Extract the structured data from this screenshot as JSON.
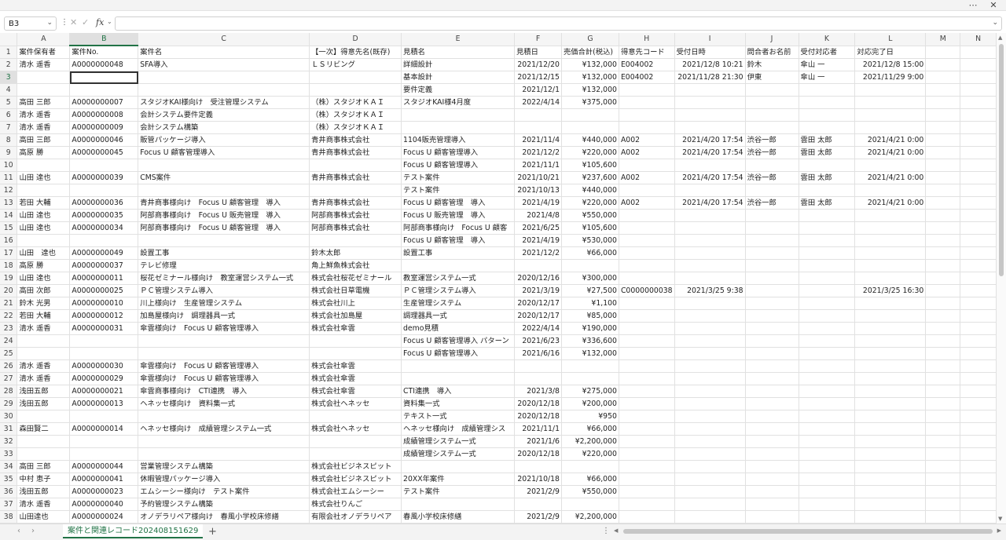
{
  "window": {
    "menu_icon": "more-horizontal-icon",
    "close_icon": "close-icon"
  },
  "formula_bar": {
    "name_box": "B3",
    "formula": ""
  },
  "columns": [
    "A",
    "B",
    "C",
    "D",
    "E",
    "F",
    "G",
    "H",
    "I",
    "J",
    "K",
    "L",
    "M",
    "N"
  ],
  "selected": {
    "row": 3,
    "col": "B"
  },
  "rows": [
    [
      "案件保有者",
      "案件No.",
      "案件名",
      "【一次】得意先名(既存)",
      "見積名",
      "見積日",
      "売価合計(税込)",
      "得意先コード",
      "受付日時",
      "問合者お名前",
      "受付対応者",
      "対応完了日",
      "",
      ""
    ],
    [
      "清水 遥香",
      "A0000000048",
      "SFA導入",
      "ＬＳリビング",
      "詳細設計",
      "2021/12/20",
      "¥132,000",
      "E004002",
      "2021/12/8 10:21",
      "鈴木",
      "傘山 一",
      "2021/12/8 15:00",
      "",
      ""
    ],
    [
      "",
      "",
      "",
      "",
      "基本設計",
      "2021/12/15",
      "¥132,000",
      "E004002",
      "2021/11/28 21:30",
      "伊東",
      "傘山 一",
      "2021/11/29 9:00",
      "",
      ""
    ],
    [
      "",
      "",
      "",
      "",
      "要件定義",
      "2021/12/1",
      "¥132,000",
      "",
      "",
      "",
      "",
      "",
      "",
      ""
    ],
    [
      "高田 三郎",
      "A0000000007",
      "スタジオKAI様向け　受注管理システム",
      "（株）スタジオＫＡＩ",
      "スタジオKAI様4月度",
      "2022/4/14",
      "¥375,000",
      "",
      "",
      "",
      "",
      "",
      "",
      ""
    ],
    [
      "清水 遥香",
      "A0000000008",
      "会計システム要件定義",
      "（株）スタジオＫＡＩ",
      "",
      "",
      "",
      "",
      "",
      "",
      "",
      "",
      "",
      ""
    ],
    [
      "清水 遥香",
      "A0000000009",
      "会計システム構築",
      "（株）スタジオＫＡＩ",
      "",
      "",
      "",
      "",
      "",
      "",
      "",
      "",
      "",
      ""
    ],
    [
      "高田 三郎",
      "A0000000046",
      "販管パッケージ導入",
      "青井商事株式会社",
      "1104販売管理導入",
      "2021/11/4",
      "¥440,000",
      "A002",
      "2021/4/20 17:54",
      "渋谷一郎",
      "雲田 太郎",
      "2021/4/21 0:00",
      "",
      ""
    ],
    [
      "高原 勝",
      "A0000000045",
      "Focus U 顧客管理導入",
      "青井商事株式会社",
      "Focus U 顧客管理導入",
      "2021/12/2",
      "¥220,000",
      "A002",
      "2021/4/20 17:54",
      "渋谷一郎",
      "雲田 太郎",
      "2021/4/21 0:00",
      "",
      ""
    ],
    [
      "",
      "",
      "",
      "",
      "Focus U 顧客管理導入",
      "2021/11/1",
      "¥105,600",
      "",
      "",
      "",
      "",
      "",
      "",
      ""
    ],
    [
      "山田 達也",
      "A0000000039",
      "CMS案件",
      "青井商事株式会社",
      "テスト案件",
      "2021/10/21",
      "¥237,600",
      "A002",
      "2021/4/20 17:54",
      "渋谷一郎",
      "雲田 太郎",
      "2021/4/21 0:00",
      "",
      ""
    ],
    [
      "",
      "",
      "",
      "",
      "テスト案件",
      "2021/10/13",
      "¥440,000",
      "",
      "",
      "",
      "",
      "",
      "",
      ""
    ],
    [
      "若田 大輔",
      "A0000000036",
      "青井商事様向け　Focus U 顧客管理　導入",
      "青井商事株式会社",
      "Focus U 顧客管理　導入",
      "2021/4/19",
      "¥220,000",
      "A002",
      "2021/4/20 17:54",
      "渋谷一郎",
      "雲田 太郎",
      "2021/4/21 0:00",
      "",
      ""
    ],
    [
      "山田 達也",
      "A0000000035",
      "阿部商事様向け　Focus U 販売管理　導入",
      "阿部商事株式会社",
      "Focus U 販売管理　導入",
      "2021/4/8",
      "¥550,000",
      "",
      "",
      "",
      "",
      "",
      "",
      ""
    ],
    [
      "山田 達也",
      "A0000000034",
      "阿部商事様向け　Focus U 顧客管理　導入",
      "阿部商事株式会社",
      "阿部商事様向け　Focus U 顧客",
      "2021/6/25",
      "¥105,600",
      "",
      "",
      "",
      "",
      "",
      "",
      ""
    ],
    [
      "",
      "",
      "",
      "",
      "Focus U 顧客管理　導入",
      "2021/4/19",
      "¥530,000",
      "",
      "",
      "",
      "",
      "",
      "",
      ""
    ],
    [
      "山田　達也",
      "A0000000049",
      "設置工事",
      "鈴木太郎",
      "設置工事",
      "2021/12/2",
      "¥66,000",
      "",
      "",
      "",
      "",
      "",
      "",
      ""
    ],
    [
      "高原 勝",
      "A0000000037",
      "テレビ修理",
      "角上鮮魚株式会社",
      "",
      "",
      "",
      "",
      "",
      "",
      "",
      "",
      "",
      ""
    ],
    [
      "山田 達也",
      "A0000000011",
      "桜花ゼミナール様向け　教室運営システム一式",
      "株式会社桜花ゼミナール",
      "教室運営システム一式",
      "2020/12/16",
      "¥300,000",
      "",
      "",
      "",
      "",
      "",
      "",
      ""
    ],
    [
      "高田 次郎",
      "A0000000025",
      "ＰＣ管理システム導入",
      "株式会社日草電機",
      "ＰＣ管理システム導入",
      "2021/3/19",
      "¥27,500",
      "C0000000038",
      "2021/3/25 9:38",
      "",
      "",
      "2021/3/25 16:30",
      "",
      ""
    ],
    [
      "鈴木 光男",
      "A0000000010",
      "川上様向け　生産管理システム",
      "株式会社川上",
      "生産管理システム",
      "2020/12/17",
      "¥1,100",
      "",
      "",
      "",
      "",
      "",
      "",
      ""
    ],
    [
      "若田 大輔",
      "A0000000012",
      "加島屋様向け　調理器具一式",
      "株式会社加島屋",
      "調理器具一式",
      "2020/12/17",
      "¥85,000",
      "",
      "",
      "",
      "",
      "",
      "",
      ""
    ],
    [
      "清水 遥香",
      "A0000000031",
      "傘雲様向け　Focus U 顧客管理導入",
      "株式会社傘雲",
      "demo見積",
      "2022/4/14",
      "¥190,000",
      "",
      "",
      "",
      "",
      "",
      "",
      ""
    ],
    [
      "",
      "",
      "",
      "",
      "Focus U 顧客管理導入 パターン",
      "2021/6/23",
      "¥336,600",
      "",
      "",
      "",
      "",
      "",
      "",
      ""
    ],
    [
      "",
      "",
      "",
      "",
      "Focus U 顧客管理導入",
      "2021/6/16",
      "¥132,000",
      "",
      "",
      "",
      "",
      "",
      "",
      ""
    ],
    [
      "清水 遥香",
      "A0000000030",
      "傘雲様向け　Focus U 顧客管理導入",
      "株式会社傘雲",
      "",
      "",
      "",
      "",
      "",
      "",
      "",
      "",
      "",
      ""
    ],
    [
      "清水 遥香",
      "A0000000029",
      "傘雲様向け　Focus U 顧客管理導入",
      "株式会社傘雲",
      "",
      "",
      "",
      "",
      "",
      "",
      "",
      "",
      "",
      ""
    ],
    [
      "浅田五郎",
      "A0000000021",
      "傘雲商事様向け　CTI連携　導入",
      "株式会社傘雲",
      "CTI連携　導入",
      "2021/3/8",
      "¥275,000",
      "",
      "",
      "",
      "",
      "",
      "",
      ""
    ],
    [
      "浅田五郎",
      "A0000000013",
      "ヘネッセ様向け　資料集一式",
      "株式会社ヘネッセ",
      "資料集一式",
      "2020/12/18",
      "¥200,000",
      "",
      "",
      "",
      "",
      "",
      "",
      ""
    ],
    [
      "",
      "",
      "",
      "",
      "テキスト一式",
      "2020/12/18",
      "¥950",
      "",
      "",
      "",
      "",
      "",
      "",
      ""
    ],
    [
      "森田賢二",
      "A0000000014",
      "ヘネッセ様向け　成績管理システム一式",
      "株式会社ヘネッセ",
      "ヘネッセ様向け　成績管理シス",
      "2021/11/1",
      "¥66,000",
      "",
      "",
      "",
      "",
      "",
      "",
      ""
    ],
    [
      "",
      "",
      "",
      "",
      "成績管理システム一式",
      "2021/1/6",
      "¥2,200,000",
      "",
      "",
      "",
      "",
      "",
      "",
      ""
    ],
    [
      "",
      "",
      "",
      "",
      "成績管理システム一式",
      "2020/12/18",
      "¥220,000",
      "",
      "",
      "",
      "",
      "",
      "",
      ""
    ],
    [
      "高田 三郎",
      "A0000000044",
      "営業管理システム構築",
      "株式会社ビジネスピット",
      "",
      "",
      "",
      "",
      "",
      "",
      "",
      "",
      "",
      ""
    ],
    [
      "中村 恵子",
      "A0000000041",
      "休暇管理パッケージ導入",
      "株式会社ビジネスピット",
      "20XX年案件",
      "2021/10/18",
      "¥66,000",
      "",
      "",
      "",
      "",
      "",
      "",
      ""
    ],
    [
      "浅田五郎",
      "A0000000023",
      "エムシーシー様向け　テスト案件",
      "株式会社エムシーシー",
      "テスト案件",
      "2021/2/9",
      "¥550,000",
      "",
      "",
      "",
      "",
      "",
      "",
      ""
    ],
    [
      "清水 遥香",
      "A0000000040",
      "予約管理システム構築",
      "株式会社りんご",
      "",
      "",
      "",
      "",
      "",
      "",
      "",
      "",
      "",
      ""
    ],
    [
      "山田達也",
      "A0000000024",
      "オノデラリペア様向け　春風小学校床修繕",
      "有限会社オノデラリペア",
      "春風小学校床修繕",
      "2021/2/9",
      "¥2,200,000",
      "",
      "",
      "",
      "",
      "",
      "",
      ""
    ]
  ],
  "numeric_cols": [
    5,
    6,
    8,
    11
  ],
  "sheet_tab": "案件と関連レコード202408151629",
  "add_sheet_label": "+"
}
